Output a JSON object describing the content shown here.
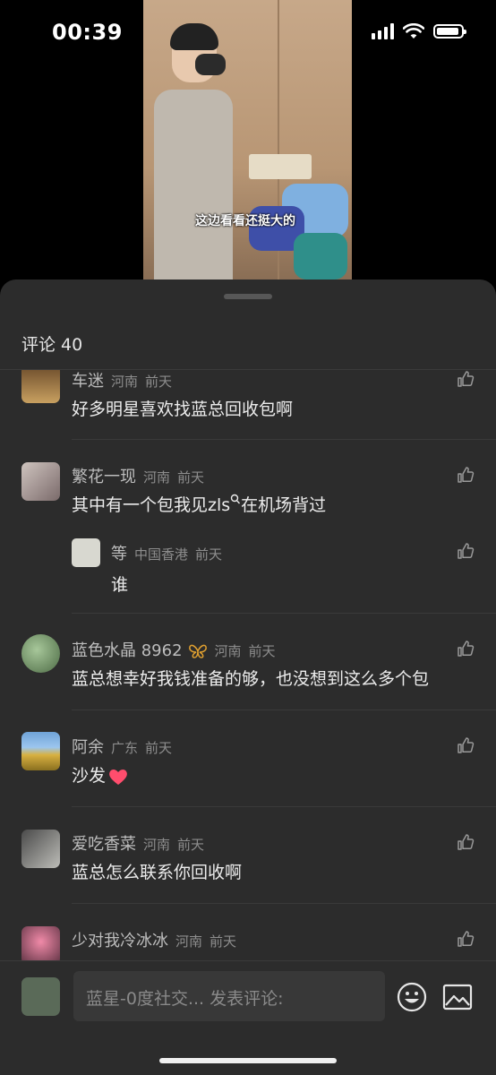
{
  "status_bar": {
    "time": "00:39"
  },
  "video": {
    "caption": "这边看看还挺大的"
  },
  "sheet": {
    "title": "评论 40"
  },
  "comments": [
    {
      "name": "车迷",
      "location": "河南",
      "time": "前天",
      "text": "好多明星喜欢找蓝总回收包啊"
    },
    {
      "name": "繁花一现",
      "location": "河南",
      "time": "前天",
      "text": "其中有一个包我见zls",
      "text_after": "在机场背过",
      "reply": {
        "name": "等",
        "location": "中国香港",
        "time": "前天",
        "text": "谁"
      }
    },
    {
      "name": "蓝色水晶 8962",
      "location": "河南",
      "time": "前天",
      "text": "蓝总想幸好我钱准备的够，也没想到这么多个包"
    },
    {
      "name": "阿余",
      "location": "广东",
      "time": "前天",
      "text": "沙发"
    },
    {
      "name": "爱吃香菜",
      "location": "河南",
      "time": "前天",
      "text": "蓝总怎么联系你回收啊"
    },
    {
      "name": "少对我冷冰冰",
      "location": "河南",
      "time": "前天",
      "text": ""
    }
  ],
  "input": {
    "placeholder": "蓝星-0度社交... 发表评论:"
  },
  "icons": {
    "like": "thumbs-up-icon",
    "search": "search-icon",
    "badge": "butterfly-badge-icon",
    "heart": "heart-icon",
    "emoji": "emoji-icon",
    "image": "image-icon"
  },
  "colors": {
    "sheet_bg": "#2c2c2c",
    "heart": "#ff4d6d",
    "badge": "#e0a030"
  }
}
